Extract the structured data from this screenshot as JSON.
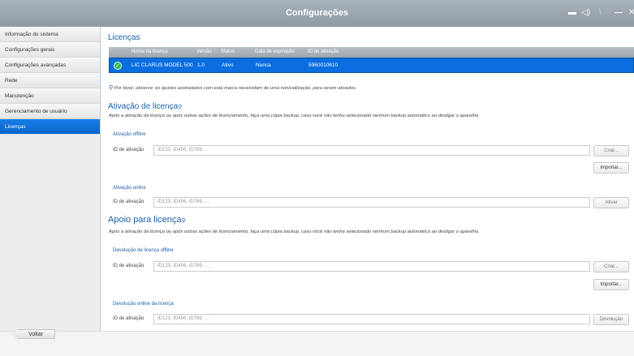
{
  "window": {
    "title": "Configurações"
  },
  "titlebar_icons": [
    "keyboard-icon",
    "speaker-icon",
    "restore-icon",
    "minimize-icon",
    "close-icon"
  ],
  "sidebar": {
    "items": [
      {
        "label": "Informação do sistema"
      },
      {
        "label": "Configurações gerais"
      },
      {
        "label": "Configurações avançadas"
      },
      {
        "label": "Rede"
      },
      {
        "label": "Manutenção"
      },
      {
        "label": "Gerenciamento de usuário"
      },
      {
        "label": "Licenças",
        "active": true
      }
    ]
  },
  "licenses": {
    "title": "Licenças",
    "columns": [
      "Nome da licença",
      "Versão",
      "Status",
      "Data de expiração",
      "ID de ativação"
    ],
    "rows": [
      {
        "name": "LIC CLARUS MODEL 500",
        "version": "1.0",
        "status": "Ativo",
        "expiration": "Nunca",
        "activation_id": "5960010610"
      }
    ],
    "note": "Por favor, observe: os ajustes assinalados com esta marca necessitam de uma reinicialização, para serem ativados."
  },
  "activation": {
    "title": "Ativação de licença",
    "description": "Após a ativação da licença ou após outras ações de licenciamento, faça uma cópia backup, caso você não tenha selecionado nenhum backup automático ao desligar o aparelho.",
    "offline": {
      "label": "Ativação offline",
      "field_label": "ID de ativação",
      "placeholder": "ID123, ID456, ID789, ...",
      "create_button": "Criar...",
      "import_button": "Importar..."
    },
    "online": {
      "label": "Ativação online",
      "field_label": "ID de ativação",
      "placeholder": "ID123, ID456, ID789, ...",
      "activate_button": "Ativar"
    }
  },
  "support": {
    "title": "Apoio para licença",
    "description": "Após a ativação da licença ou após outras ações de licenciamento, faça uma cópia backup, caso você não tenha selecionado nenhum backup automático ao desligar o aparelho.",
    "offline_return": {
      "label": "Devolução de licença offline",
      "field_label": "ID de ativação",
      "placeholder": "ID123, ID456, ID789, ...",
      "create_button": "Criar...",
      "import_button": "Importar..."
    },
    "online_return": {
      "label": "Devolução online da licença",
      "field_label": "ID de ativação",
      "placeholder": "ID123, ID456, ID789, ...",
      "return_button": "Devolução"
    }
  },
  "footer": {
    "back_label": "Voltar"
  }
}
